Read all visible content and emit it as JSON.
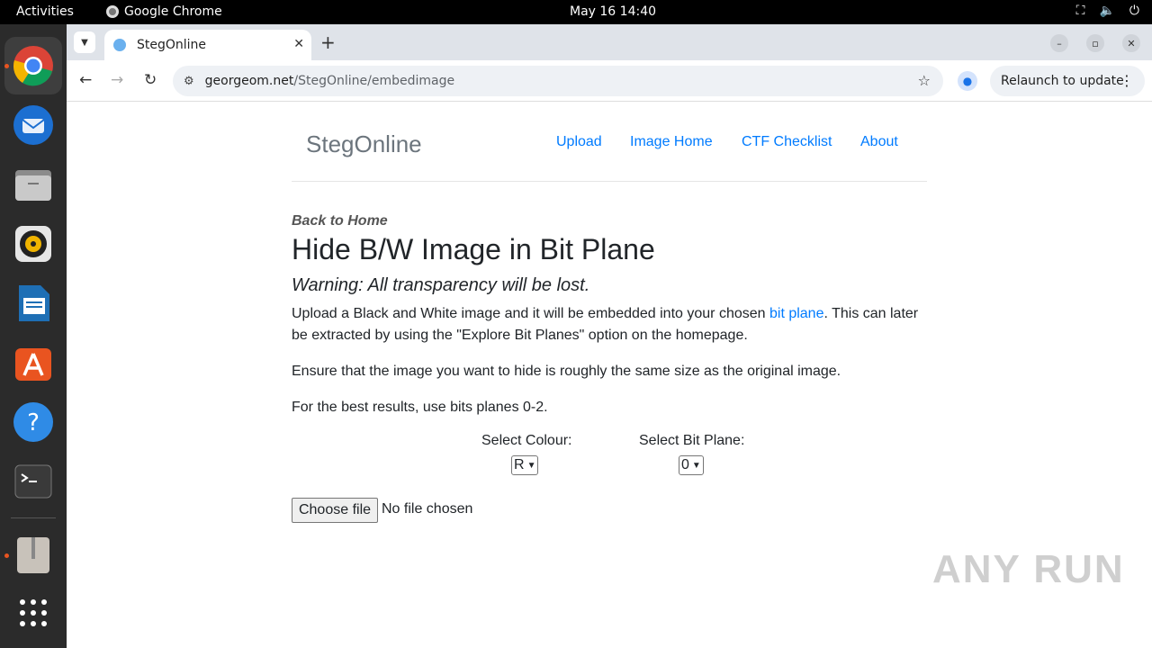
{
  "topbar": {
    "activities": "Activities",
    "app": "Google Chrome",
    "clock": "May 16  14:40",
    "tray_icons": [
      "network-icon",
      "volume-icon",
      "power-icon"
    ]
  },
  "dock": {
    "items": [
      "chrome-icon",
      "thunderbird-icon",
      "files-icon",
      "rhythmbox-icon",
      "writer-icon",
      "app-center-icon",
      "help-icon",
      "terminal-icon",
      "archive-icon",
      "app-grid-icon"
    ]
  },
  "browser": {
    "tab_title": "StegOnline",
    "url_host": "georgeom.net",
    "url_path": "/StegOnline/embedimage",
    "relaunch": "Relaunch to update"
  },
  "site": {
    "brand": "StegOnline",
    "nav": [
      "Upload",
      "Image Home",
      "CTF Checklist",
      "About"
    ]
  },
  "content": {
    "back": "Back to Home",
    "title": "Hide B/W Image in Bit Plane",
    "warning": "Warning: All transparency will be lost.",
    "p1_pre": "Upload a Black and White image and it will be embedded into your chosen ",
    "p1_link": "bit plane",
    "p1_post": ". This can later be extracted by using the \"Explore Bit Planes\" option on the homepage.",
    "p2": "Ensure that the image you want to hide is roughly the same size as the original image.",
    "p3": "For the best results, use bits planes 0-2.",
    "colour_label": "Select Colour:",
    "colour_value": "R",
    "bitplane_label": "Select Bit Plane:",
    "bitplane_value": "0",
    "choose_file": "Choose file",
    "no_file": "No file chosen"
  },
  "watermark": "ANY RUN"
}
